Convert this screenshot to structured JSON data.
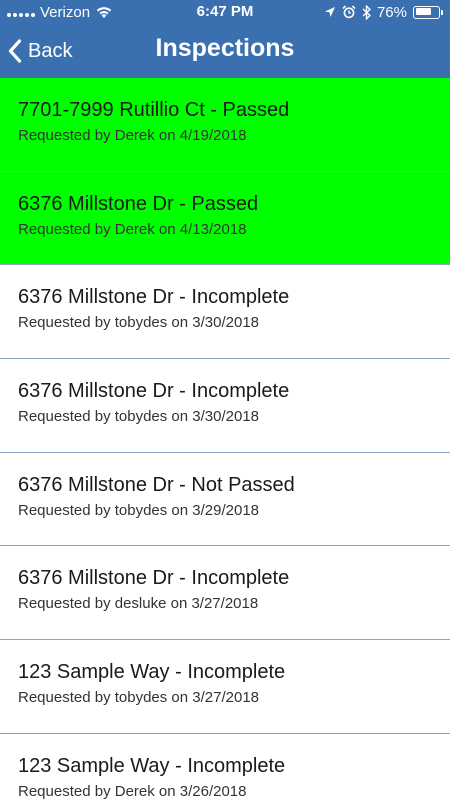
{
  "status_bar": {
    "carrier": "Verizon",
    "time": "6:47 PM",
    "battery_percent": "76%",
    "battery_level": 0.76,
    "icons": [
      "signal-icon",
      "wifi-icon",
      "location-icon",
      "alarm-icon",
      "bluetooth-icon",
      "battery-icon"
    ]
  },
  "nav": {
    "back_label": "Back",
    "title": "Inspections"
  },
  "colors": {
    "nav_background": "#3a6fb0",
    "passed_background": "#00ff00",
    "separator": "#8aa3bf"
  },
  "inspections": [
    {
      "title": "7701-7999 Rutillio Ct - Passed",
      "subtitle": "Requested by Derek on 4/19/2018",
      "status": "passed"
    },
    {
      "title": "6376 Millstone Dr - Passed",
      "subtitle": "Requested by Derek on 4/13/2018",
      "status": "passed"
    },
    {
      "title": "6376 Millstone Dr - Incomplete",
      "subtitle": "Requested by tobydes on 3/30/2018",
      "status": "incomplete"
    },
    {
      "title": "6376 Millstone Dr - Incomplete",
      "subtitle": "Requested by tobydes on 3/30/2018",
      "status": "incomplete"
    },
    {
      "title": "6376 Millstone Dr - Not Passed",
      "subtitle": "Requested by tobydes on 3/29/2018",
      "status": "not-passed"
    },
    {
      "title": "6376 Millstone Dr - Incomplete",
      "subtitle": "Requested by desluke on 3/27/2018",
      "status": "incomplete"
    },
    {
      "title": "123 Sample Way - Incomplete",
      "subtitle": "Requested by tobydes on 3/27/2018",
      "status": "incomplete"
    },
    {
      "title": "123 Sample Way - Incomplete",
      "subtitle": "Requested by Derek on 3/26/2018",
      "status": "incomplete"
    }
  ]
}
